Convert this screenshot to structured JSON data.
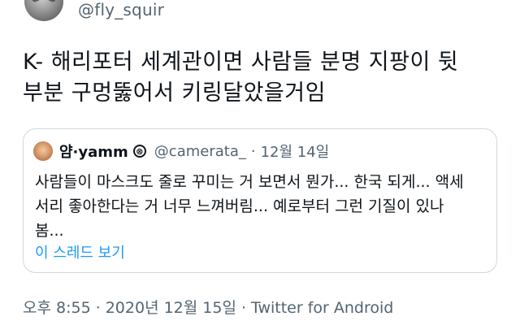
{
  "author": {
    "handle": "@fly_squir",
    "avatar_icon": "gray-cat-avatar"
  },
  "tweet": {
    "lines": [
      "K- 해리포터 세계관이면 사람들 분명 지팡이 뒷",
      "부분 구멍뚫어서 키링달았을거임"
    ]
  },
  "quote": {
    "name": "얌·yamm",
    "badge_icon": "x-circle-icon",
    "badge_glyph": "⊗",
    "handle": "@camerata_",
    "dot": "·",
    "date": "12월 14일",
    "lines": [
      "사람들이 마스크도 줄로 꾸미는 거 보면서 뭔가... 한국 되게... 액세",
      "서리 좋아한다는 거 너무 느껴버림... 예로부터 그런 기질이 있나",
      "봄..."
    ],
    "thread_link": "이 스레드 보기"
  },
  "meta": {
    "time": "오후 8:55",
    "sep1": "·",
    "date": "2020년 12월 15일",
    "sep2": "·",
    "source": "Twitter for Android"
  },
  "colors": {
    "text": "#0f1419",
    "secondary": "#536471",
    "link": "#1d9bf0",
    "border": "#cfd9de"
  }
}
